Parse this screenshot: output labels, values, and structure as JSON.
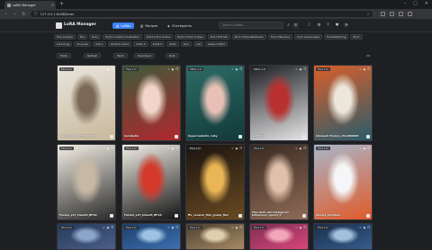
{
  "browser": {
    "tab_title": "LoRA Manager",
    "url": "127.0.0.1:8188/loras",
    "new_tab": "+",
    "controls": [
      "–",
      "□",
      "✕"
    ]
  },
  "app": {
    "title": "LoRA Manager",
    "nav": [
      {
        "label": "LoRAs",
        "icon": "layers-icon",
        "active": true
      },
      {
        "label": "Recipes",
        "icon": "book-icon",
        "active": false
      },
      {
        "label": "Checkpoints",
        "icon": "cube-icon",
        "active": false
      }
    ],
    "search_placeholder": "Search LoRAs..."
  },
  "filters": {
    "row1": [
      "flux-sd-style",
      "flux",
      "fluxy",
      "flux1.0 realism illustration",
      "flux1.0 flux anime",
      "flux1.0 flux1.0 style",
      "flux1 Portrait",
      "flux1.0 MandalaFusion",
      "flux1 Fabulous",
      "flux1 Landscapes",
      "flux1Sketching",
      "flux1"
    ],
    "row2": [
      "Lora-tings",
      "hunyuan",
      "sdxl 1",
      "sdxl1.0 anime",
      "sdxl1.0",
      "sdxl3.5",
      "sdxl1",
      "emu",
      "sub",
      "base-conflict"
    ]
  },
  "toolbar": {
    "buttons": [
      "Folds",
      "Refresh",
      "Fetch",
      "Download",
      "Bulk"
    ]
  },
  "cards": [
    {
      "base": "Flux.1 D",
      "name": "blondeportrait18_v016",
      "colors": [
        "#e9e5de",
        "#c8b89b",
        "#7a6a55"
      ]
    },
    {
      "base": "Flux.1 D",
      "name": "Aurabella",
      "colors": [
        "#3f5a3a",
        "#b1272e",
        "#f0d5c8"
      ]
    },
    {
      "base": "SDXL 1.0",
      "name": "hyperrealistic_ruby",
      "colors": [
        "#2d6b66",
        "#113a3a",
        "#e8c0b5"
      ]
    },
    {
      "base": "SDXL 1.0",
      "name": "Goth c1",
      "colors": [
        "#1d1f24",
        "#e6e6e6",
        "#b83030"
      ]
    },
    {
      "base": "Flux.1 D",
      "name": "Inkwash Fusion_v30-000008",
      "colors": [
        "#d95f2b",
        "#2a5c6b",
        "#ede6da"
      ]
    },
    {
      "base": "Flux.1 D",
      "name": "Fusion_v27_Inked3_BF16",
      "colors": [
        "#f4efe6",
        "#2b2b2b",
        "#c7b8a4"
      ]
    },
    {
      "base": "Flux.1 D",
      "name": "Fusion_v27_Inked3_BF16",
      "colors": [
        "#f1ede5",
        "#151515",
        "#d33a2c"
      ]
    },
    {
      "base": "Flux.1 D",
      "name": "ffv_cesario_film_grade_flux",
      "colors": [
        "#1a1410",
        "#6a4a22",
        "#e9b555"
      ]
    },
    {
      "base": "Flux.1 D",
      "name": "Flux Rich Girl Instagram Influencer_epoch_5",
      "colors": [
        "#3a2a22",
        "#8e6b56",
        "#e0c0aa"
      ]
    },
    {
      "base": "Flux.1 D",
      "name": "Snow4_shuntal1",
      "colors": [
        "#a9b6c9",
        "#e05a2a",
        "#f6f6f8"
      ]
    },
    {
      "base": "Flux.1 D",
      "name": "",
      "colors": [
        "#263a5c",
        "#4b5f86",
        "#8da5c8"
      ]
    },
    {
      "base": "Flux.1 D",
      "name": "",
      "colors": [
        "#1e3f6a",
        "#3d6fb0",
        "#9fc1e4"
      ]
    },
    {
      "base": "Flux.1 D",
      "name": "",
      "colors": [
        "#4b4133",
        "#a78a62",
        "#e0cfae"
      ]
    },
    {
      "base": "Flux.1 D",
      "name": "",
      "colors": [
        "#7b2f52",
        "#d9467a",
        "#f3a6b9"
      ]
    },
    {
      "base": "Flux.1 D",
      "name": "",
      "colors": [
        "#1c2f4c",
        "#345c8c",
        "#a1c0dc"
      ]
    }
  ]
}
